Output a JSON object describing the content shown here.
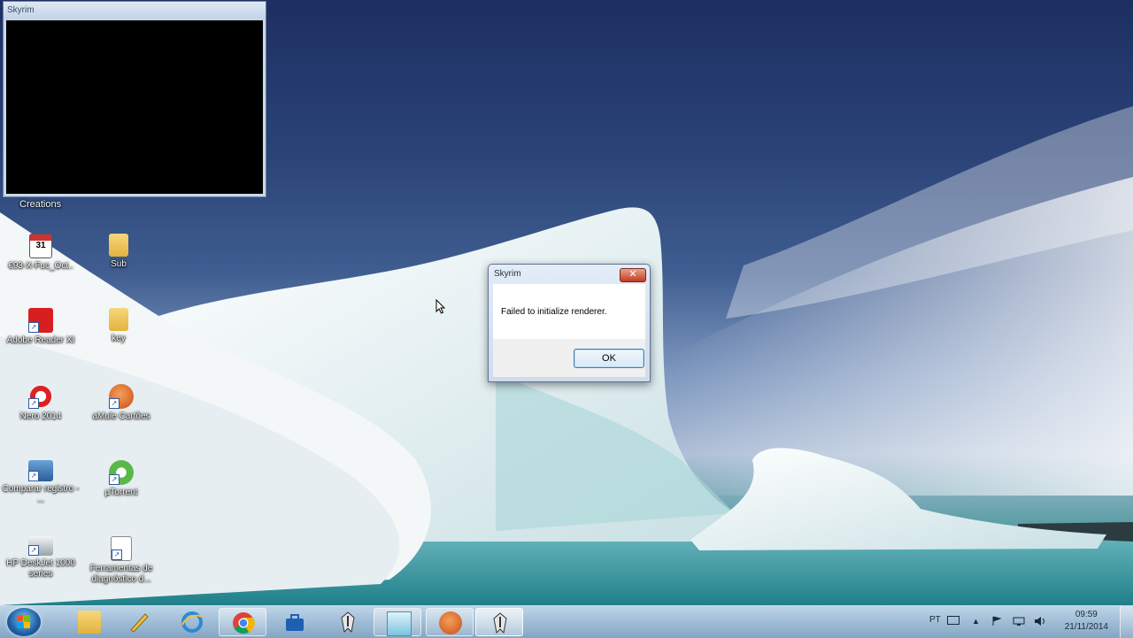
{
  "game_window": {
    "title": "Skyrim"
  },
  "desktop": {
    "creations_label": "Creations",
    "icons": [
      {
        "label": "€93-X-Fuc_Oct..",
        "icon": "calendar-icon"
      },
      {
        "label": "Sub",
        "icon": "folder-icon"
      },
      {
        "label": "Adobe Reader XI",
        "icon": "adobe-reader-icon"
      },
      {
        "label": "key",
        "icon": "folder-icon"
      },
      {
        "label": "Nero 2014",
        "icon": "nero-icon"
      },
      {
        "label": "aMule Cartões",
        "icon": "amule-icon"
      },
      {
        "label": "Comparar registro - ...",
        "icon": "compare-icon"
      },
      {
        "label": "µTorrent",
        "icon": "utorrent-icon"
      },
      {
        "label": "HP DeskJet 1000 series",
        "icon": "printer-icon"
      },
      {
        "label": "Ferramentas de diagnóstico d...",
        "icon": "document-icon"
      }
    ]
  },
  "dialog": {
    "title": "Skyrim",
    "close_label": "✕",
    "message": "Failed to initialize renderer.",
    "ok_label": "OK"
  },
  "taskbar": {
    "pinned": [
      {
        "name": "explorer",
        "icon": "folder-icon",
        "state": "pinned"
      },
      {
        "name": "paint",
        "icon": "paint-icon",
        "state": "pinned"
      },
      {
        "name": "internet-explorer",
        "icon": "internet-explorer-icon",
        "state": "pinned"
      },
      {
        "name": "chrome",
        "icon": "chrome-icon",
        "state": "open"
      },
      {
        "name": "dropbox",
        "icon": "briefcase-icon",
        "state": "pinned"
      },
      {
        "name": "skyrim",
        "icon": "skyrim-icon",
        "state": "pinned"
      },
      {
        "name": "virtualbox",
        "icon": "window-icon",
        "state": "open"
      },
      {
        "name": "amule",
        "icon": "amule-icon",
        "state": "open"
      },
      {
        "name": "skyrim-running",
        "icon": "skyrim-icon",
        "state": "active"
      }
    ],
    "tray": {
      "language": "PT"
    },
    "clock": {
      "time": "09:59",
      "date": "21/11/2014"
    }
  },
  "colors": {
    "accent": "#3c7fb1",
    "close_red": "#c23b22"
  }
}
